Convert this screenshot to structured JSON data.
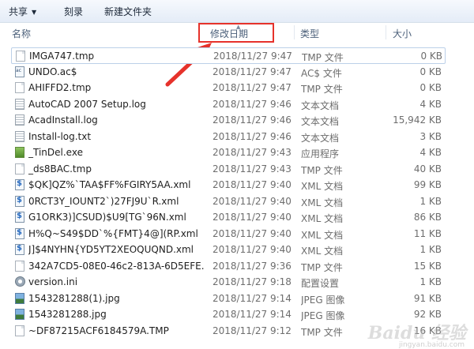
{
  "toolbar": {
    "share": "共享",
    "burn": "刻录",
    "new_folder": "新建文件夹"
  },
  "columns": {
    "name": "名称",
    "date": "修改日期",
    "type": "类型",
    "size": "大小"
  },
  "files": [
    {
      "name": "IMGA747.tmp",
      "date": "2018/11/27 9:47",
      "type": "TMP 文件",
      "size": "0 KB",
      "icon": "doc-icon"
    },
    {
      "name": "UNDO.ac$",
      "date": "2018/11/27 9:47",
      "type": "AC$ 文件",
      "size": "0 KB",
      "icon": "acs-file-icon"
    },
    {
      "name": "AHIFFD2.tmp",
      "date": "2018/11/27 9:47",
      "type": "TMP 文件",
      "size": "0 KB",
      "icon": "doc-icon"
    },
    {
      "name": "AutoCAD 2007 Setup.log",
      "date": "2018/11/27 9:46",
      "type": "文本文档",
      "size": "4 KB",
      "icon": "text-doc-icon"
    },
    {
      "name": "AcadInstall.log",
      "date": "2018/11/27 9:46",
      "type": "文本文档",
      "size": "15,942 KB",
      "icon": "text-doc-icon"
    },
    {
      "name": "Install-log.txt",
      "date": "2018/11/27 9:46",
      "type": "文本文档",
      "size": "3 KB",
      "icon": "text-doc-icon"
    },
    {
      "name": "_TinDel.exe",
      "date": "2018/11/27 9:43",
      "type": "应用程序",
      "size": "4 KB",
      "icon": "exe-icon"
    },
    {
      "name": "_ds8BAC.tmp",
      "date": "2018/11/27 9:43",
      "type": "TMP 文件",
      "size": "40 KB",
      "icon": "doc-icon"
    },
    {
      "name": "$QK]QZ%`TAA$FF%FGIRY5AA.xml",
      "date": "2018/11/27 9:40",
      "type": "XML 文档",
      "size": "99 KB",
      "icon": "xml-icon"
    },
    {
      "name": "0RCT3Y_IOUNT2`)27FJ9U`R.xml",
      "date": "2018/11/27 9:40",
      "type": "XML 文档",
      "size": "1 KB",
      "icon": "xml-icon"
    },
    {
      "name": "G1ORK3)]CSUD)$U9[TG`96N.xml",
      "date": "2018/11/27 9:40",
      "type": "XML 文档",
      "size": "86 KB",
      "icon": "xml-icon"
    },
    {
      "name": "H%Q~S49$DD`%{FMT}4@](RP.xml",
      "date": "2018/11/27 9:40",
      "type": "XML 文档",
      "size": "11 KB",
      "icon": "xml-icon"
    },
    {
      "name": "J]$4NYHN{YD5YT2XEOQUQND.xml",
      "date": "2018/11/27 9:40",
      "type": "XML 文档",
      "size": "1 KB",
      "icon": "xml-icon"
    },
    {
      "name": "342A7CD5-08E0-46c2-813A-6D5EFE...",
      "date": "2018/11/27 9:36",
      "type": "TMP 文件",
      "size": "15 KB",
      "icon": "doc-icon"
    },
    {
      "name": "version.ini",
      "date": "2018/11/27 9:18",
      "type": "配置设置",
      "size": "1 KB",
      "icon": "settings-file-icon"
    },
    {
      "name": "1543281288(1).jpg",
      "date": "2018/11/27 9:14",
      "type": "JPEG 图像",
      "size": "91 KB",
      "icon": "image-icon"
    },
    {
      "name": "1543281288.jpg",
      "date": "2018/11/27 9:14",
      "type": "JPEG 图像",
      "size": "92 KB",
      "icon": "image-icon"
    },
    {
      "name": "~DF87215ACF6184579A.TMP",
      "date": "2018/11/27 9:12",
      "type": "TMP 文件",
      "size": "16 KB",
      "icon": "doc-icon"
    }
  ],
  "watermark": "Baidu 经验",
  "watermark_sub": "jingyan.baidu.com",
  "colors": {
    "highlight": "#e6322b",
    "selection_border": "#bcd0e8",
    "header_text": "#4c607a"
  }
}
